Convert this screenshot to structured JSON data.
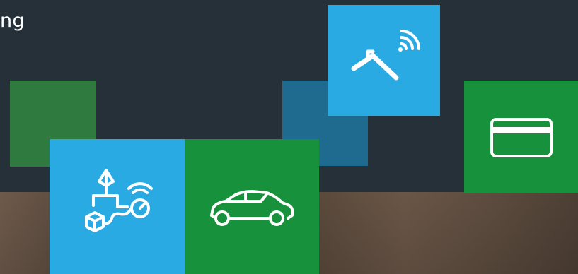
{
  "headline": {
    "text": "ng"
  },
  "tiles": [
    {
      "name": "tile-dark-green",
      "color": "#2f7a3f"
    },
    {
      "name": "tile-teal",
      "color": "#1e6b8f"
    },
    {
      "name": "tile-smart-home",
      "color": "#29aae2",
      "icon": "smart-home-wifi-icon"
    },
    {
      "name": "tile-payment-card",
      "color": "#17913b",
      "icon": "credit-card-icon"
    },
    {
      "name": "tile-iot-network",
      "color": "#29aae2",
      "icon": "iot-network-icon"
    },
    {
      "name": "tile-connected-car",
      "color": "#17913b",
      "icon": "car-icon"
    }
  ],
  "background": {
    "color": "#263039",
    "photo": "blurred-photo-strip"
  }
}
